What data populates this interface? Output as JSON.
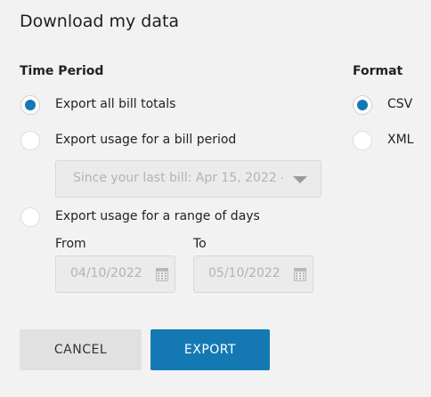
{
  "dialog": {
    "title": "Download my data"
  },
  "time_period": {
    "label": "Time Period",
    "options": [
      {
        "label": "Export all bill totals",
        "selected": true
      },
      {
        "label": "Export usage for a bill period",
        "selected": false
      },
      {
        "label": "Export usage for a range of days",
        "selected": false
      }
    ],
    "bill_period_select": {
      "value": "Since your last bill: Apr 15, 2022 - ",
      "disabled": true
    },
    "range": {
      "from_label": "From",
      "from_value": "04/10/2022",
      "to_label": "To",
      "to_value": "05/10/2022",
      "disabled": true
    }
  },
  "format": {
    "label": "Format",
    "options": [
      {
        "label": "CSV",
        "selected": true
      },
      {
        "label": "XML",
        "selected": false
      }
    ]
  },
  "actions": {
    "cancel_label": "CANCEL",
    "export_label": "EXPORT"
  },
  "colors": {
    "accent": "#1479b3",
    "background": "#f2f2f2",
    "disabled_field": "#ebebeb",
    "cancel_button": "#e1e1e1"
  },
  "icons": {
    "date_picker": "calendar-icon",
    "select_caret": "chevron-down-icon"
  }
}
